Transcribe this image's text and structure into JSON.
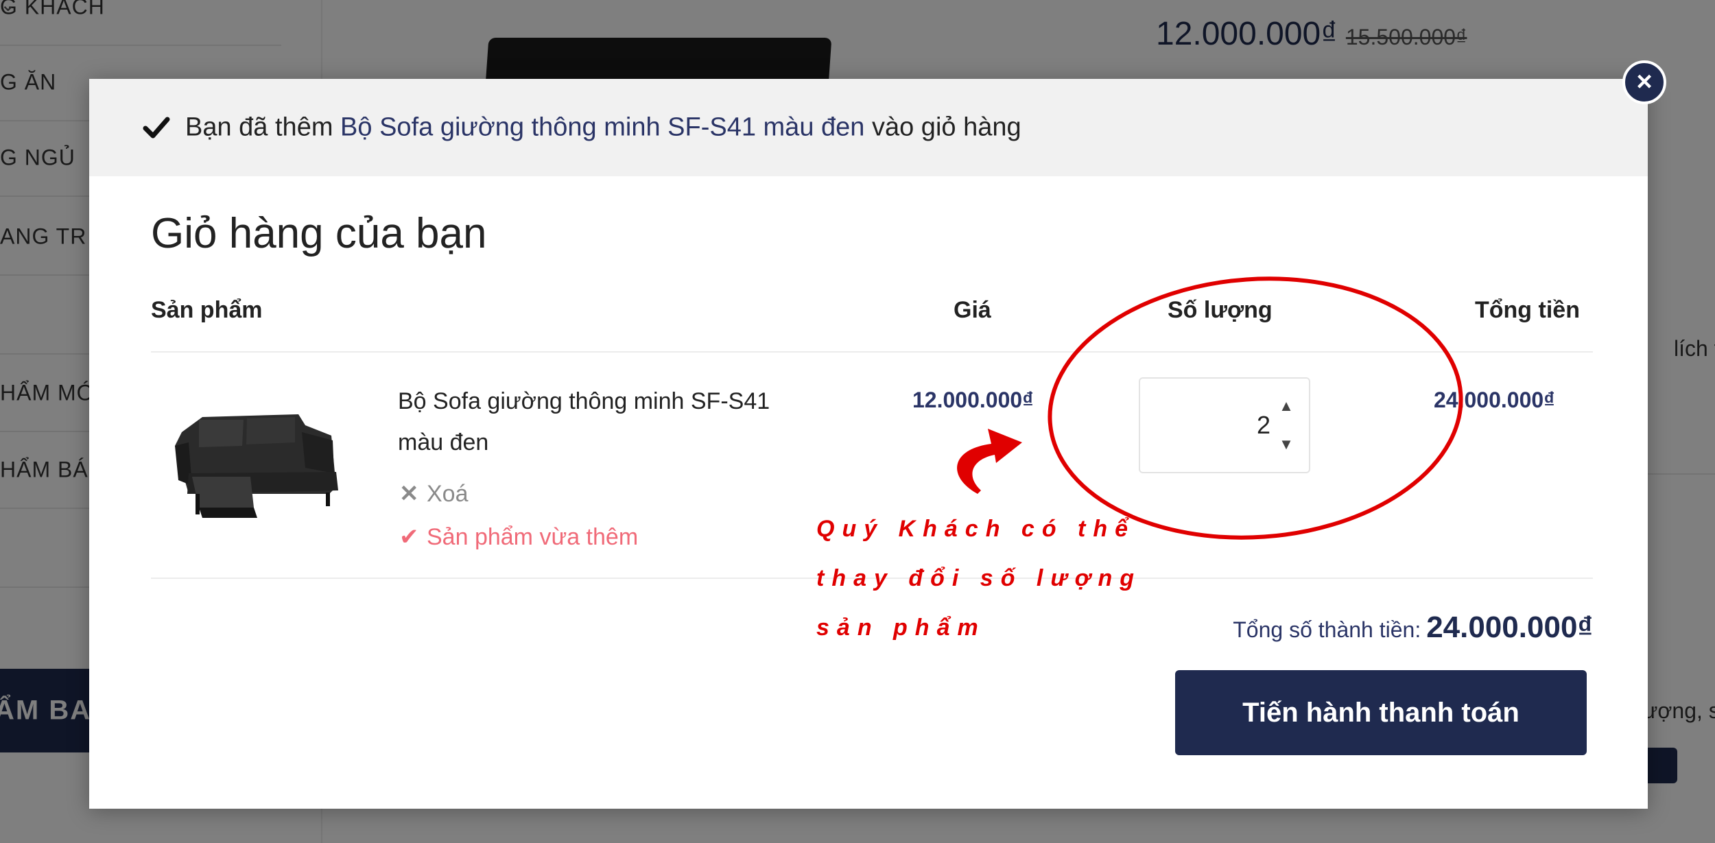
{
  "background": {
    "sidebar_categories": [
      "G KHÁCH",
      "G ĂN",
      "G NGỦ",
      "ANG TR",
      "HẨM MỚ",
      "HẨM BÁ"
    ],
    "banner_text": "ẨM BA",
    "product_price": "12.000.000₫",
    "product_old_price": "15.500.000₫",
    "right_text_1": "lích th",
    "right_text_2": "ượng, s"
  },
  "modal": {
    "notice_prefix": "Bạn đã thêm",
    "notice_product": "Bộ Sofa giường thông minh SF-S41 màu đen",
    "notice_suffix": "vào giỏ hàng",
    "close_label": "×",
    "title": "Giỏ hàng của bạn",
    "columns": {
      "product": "Sản phẩm",
      "price": "Giá",
      "quantity": "Số lượng",
      "total": "Tổng tiền"
    },
    "item": {
      "name": "Bộ Sofa giường thông minh SF-S41 màu đen",
      "remove_label": "Xoá",
      "added_label": "Sản phẩm vừa thêm",
      "price": "12.000.000₫",
      "quantity": "2",
      "total": "24.000.000₫"
    },
    "grand_total_label": "Tổng số thành tiền:",
    "grand_total_value": "24.000.000₫",
    "checkout_label": "Tiến hành thanh toán"
  },
  "annotation": {
    "lines": [
      "Quý Khách có thể",
      "thay đổi số lượng",
      "sản phẩm"
    ],
    "color": "#e00000"
  },
  "colors": {
    "primary": "#1f2a4f",
    "accent_pink": "#f06a78",
    "annotation_red": "#e00000"
  },
  "icons": {
    "notice": "check-icon",
    "close": "close-icon",
    "remove": "x-icon",
    "added": "check-icon",
    "qty_up": "chevron-up-icon",
    "qty_down": "chevron-down-icon"
  }
}
